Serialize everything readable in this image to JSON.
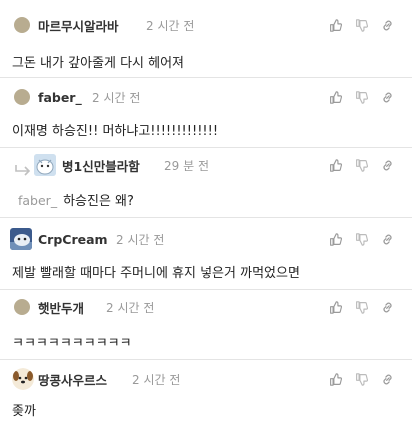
{
  "comments": [
    {
      "nickname": "마르무시알라바",
      "time": "2 시간 전",
      "text": "그돈 내가 갚아줄게 다시 헤어져",
      "avatar_icon": "dot-avatar-icon"
    },
    {
      "nickname": "faber_",
      "time": "2 시간 전",
      "text": "이재명 하승진!! 머하냐고!!!!!!!!!!!!!",
      "avatar_icon": "dot-avatar-icon"
    },
    {
      "nickname": "병1신만블라함",
      "time": "29 분 전",
      "mention": "faber_",
      "text": "하승진은 왜?",
      "avatar_icon": "cartoon-avatar-icon",
      "is_reply": true
    },
    {
      "nickname": "CrpCream",
      "time": "2 시간 전",
      "text": "제발 빨래할 때마다 주머니에 휴지 넣은거 까먹었으면",
      "avatar_icon": "photo-avatar-icon"
    },
    {
      "nickname": "햇반두개",
      "time": "2 시간 전",
      "text": "ㅋㅋㅋㅋㅋㅋㅋㅋㅋㅋ",
      "avatar_icon": "dot-avatar-icon"
    },
    {
      "nickname": "땅콩사우르스",
      "time": "2 시간 전",
      "text": "좆까",
      "avatar_icon": "dog-avatar-icon"
    }
  ],
  "action_icons": [
    "thumbs-up-icon",
    "thumbs-down-icon",
    "link-icon"
  ],
  "colors": {
    "avatar_dot": "#b8ac90",
    "divider": "#e4e4e4",
    "time": "#999999",
    "icon": "#9a9a9a"
  }
}
